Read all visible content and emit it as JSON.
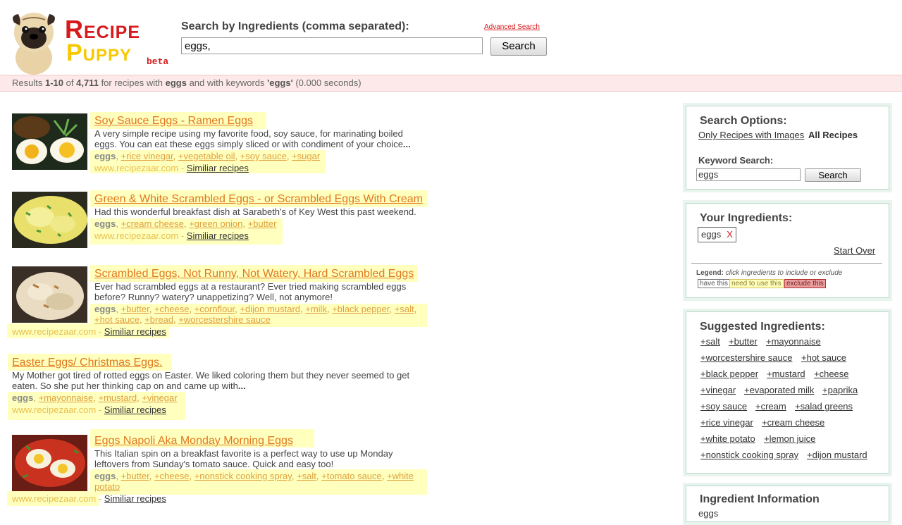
{
  "header": {
    "logo_word1": "Recipe",
    "logo_word2": "Puppy",
    "logo_beta": "beta",
    "search_label": "Search by Ingredients (comma separated):",
    "advanced_link": "Advanced Search",
    "search_value": "eggs,",
    "search_button": "Search"
  },
  "results_bar": {
    "prefix": "Results",
    "range": "1-10",
    "of": "of",
    "total": "4,711",
    "mid": "for recipes with",
    "ingredient": "eggs",
    "mid2": "and with keywords",
    "keyword": "'eggs'",
    "time": "(0.000 seconds)"
  },
  "results": [
    {
      "title": "Soy Sauce Eggs - Ramen Eggs",
      "desc": "A very simple recipe using my favorite food, soy sauce, for marinating boiled eggs. You can eat these eggs simply sliced or with condiment of your choice",
      "ellipsis": "...",
      "have": "eggs",
      "need": [
        "+rice vinegar",
        "+vegetable oil",
        "+soy sauce",
        "+sugar"
      ],
      "source": "www.recipezaar.com",
      "similar": "Similiar recipes"
    },
    {
      "title": "Green & White Scrambled Eggs - or Scrambled Eggs With Cream",
      "desc": "Had this wonderful breakfast dish at Sarabeth's of Key West this past weekend.",
      "ellipsis": "",
      "have": "eggs",
      "need": [
        "+cream cheese",
        "+green onion",
        "+butter"
      ],
      "source": "www.recipezaar.com",
      "similar": "Similiar recipes"
    },
    {
      "title": "Scrambled Eggs, Not Runny, Not Watery, Hard Scrambled Eggs",
      "desc": "Ever had scrambled eggs at a restaurant? Ever tried making scrambled eggs before? Runny? watery? unappetizing? Well, not anymore!",
      "ellipsis": "",
      "have": "eggs",
      "need": [
        "+butter",
        "+cheese",
        "+cornflour",
        "+dijon mustard",
        "+milk",
        "+black pepper",
        "+salt",
        "+hot sauce",
        "+bread",
        "+worcestershire sauce"
      ],
      "source": "www.recipezaar.com",
      "similar": "Similiar recipes"
    },
    {
      "title": "Easter Eggs/ Christmas Eggs.",
      "desc": "My Mother got tired of rotted eggs on Easter. We liked coloring them but they never seemed to get eaten. So she put her thinking cap on and came up with",
      "ellipsis": "...",
      "have": "eggs",
      "need": [
        "+mayonnaise",
        "+mustard",
        "+vinegar"
      ],
      "source": "www.recipezaar.com",
      "similar": "Similiar recipes"
    },
    {
      "title": "Eggs Napoli Aka Monday Morning Eggs",
      "desc": "This Italian spin on a breakfast favorite is a perfect way to use up Monday leftovers from Sunday's tomato sauce. Quick and easy too!",
      "ellipsis": "",
      "have": "eggs",
      "need": [
        "+butter",
        "+cheese",
        "+nonstick cooking spray",
        "+salt",
        "+tomato sauce",
        "+white potato"
      ],
      "source": "www.recipezaar.com",
      "similar": "Similiar recipes"
    }
  ],
  "sidebar": {
    "options_title": "Search Options:",
    "only_images": "Only Recipes with Images",
    "all_recipes": "All Recipes",
    "keyword_label": "Keyword Search:",
    "keyword_value": "eggs",
    "keyword_button": "Search",
    "ingredients_title": "Your Ingredients:",
    "chip": "eggs",
    "chip_remove": "X",
    "start_over": "Start Over",
    "legend_label": "Legend:",
    "legend_text": "click ingredients to include or exclude",
    "legend_have": "have this",
    "legend_need": "need to use this",
    "legend_exclude": "exclude this",
    "suggested_title": "Suggested Ingredients:",
    "suggested": [
      [
        "+salt",
        "+butter",
        "+mayonnaise"
      ],
      [
        "+worcestershire sauce",
        "+hot sauce"
      ],
      [
        "+black pepper",
        "+mustard",
        "+cheese"
      ],
      [
        "+vinegar",
        "+evaporated milk",
        "+paprika"
      ],
      [
        "+soy sauce",
        "+cream",
        "+salad greens"
      ],
      [
        "+rice vinegar",
        "+cream cheese"
      ],
      [
        "+white potato",
        "+lemon juice"
      ],
      [
        "+nonstick cooking spray",
        "+dijon mustard"
      ]
    ],
    "info_title": "Ingredient Information",
    "info_item": "eggs"
  },
  "colors": {
    "brand_red": "#d7191c",
    "brand_yellow": "#f6c800",
    "highlight": "#ffffbe",
    "title_orange": "#e07820"
  }
}
